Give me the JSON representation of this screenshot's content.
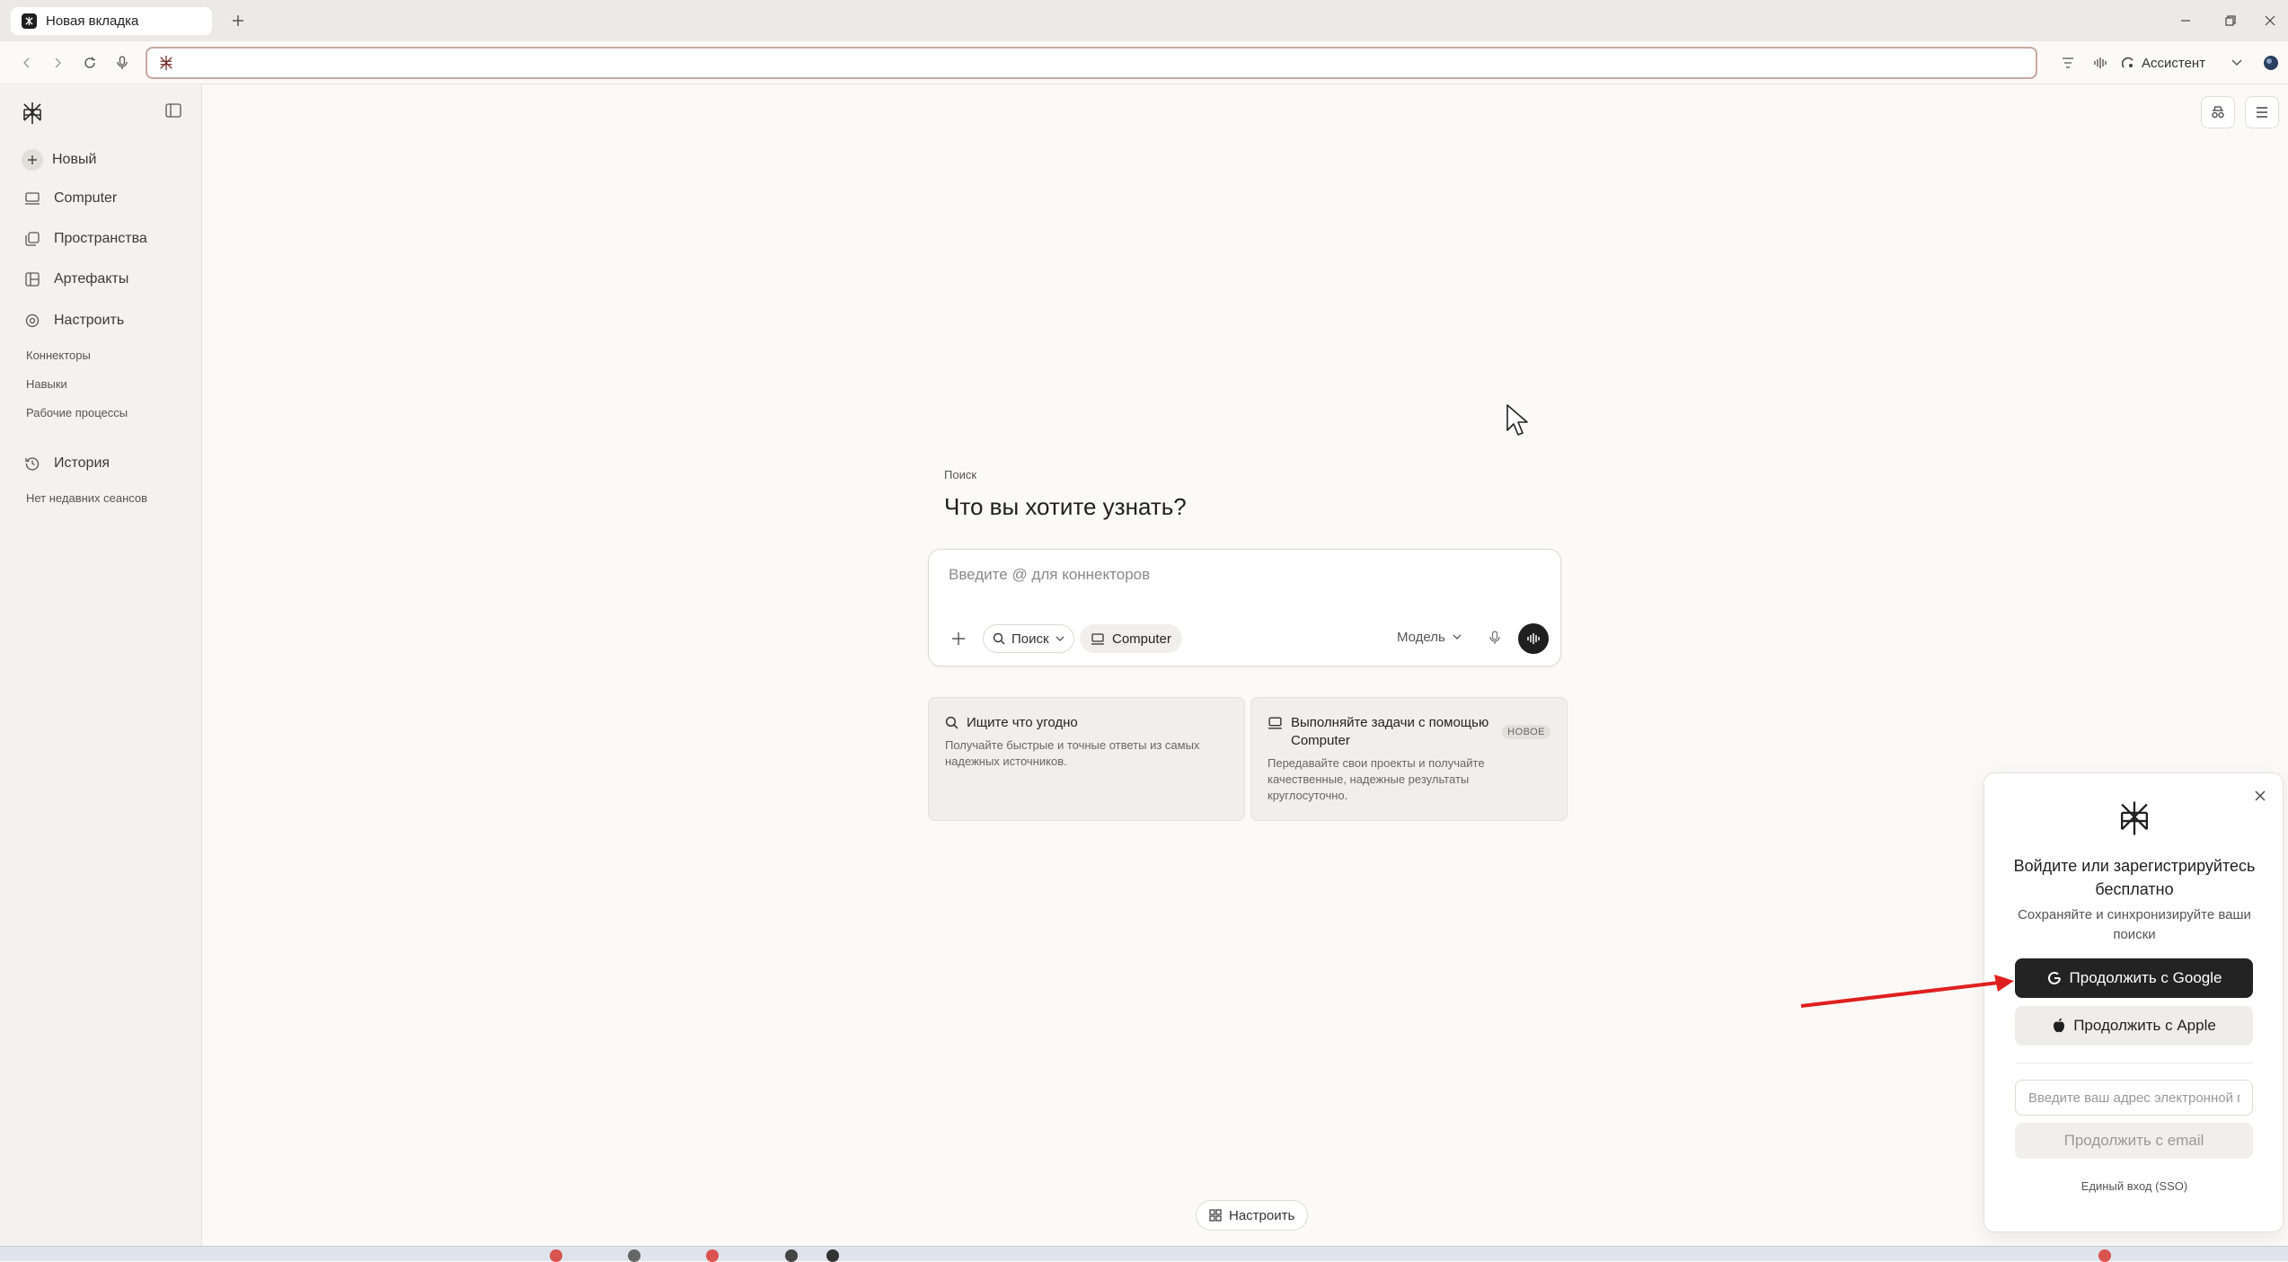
{
  "browser": {
    "tab_title": "Новая вкладка",
    "address_value": "",
    "assistant_label": "Ассистент"
  },
  "sidebar": {
    "items": [
      {
        "label": "Новый",
        "icon": "plus-icon"
      },
      {
        "label": "Computer",
        "icon": "computer-icon"
      },
      {
        "label": "Пространства",
        "icon": "spaces-icon"
      },
      {
        "label": "Артефакты",
        "icon": "artifacts-icon"
      },
      {
        "label": "Настроить",
        "icon": "customize-icon"
      }
    ],
    "sub_items": [
      "Коннекторы",
      "Навыки",
      "Рабочие процессы"
    ],
    "history_label": "История",
    "history_empty": "Нет недавних сеансов"
  },
  "main": {
    "eyebrow": "Поиск",
    "headline": "Что вы хотите узнать?",
    "composer": {
      "placeholder": "Введите @ для коннекторов",
      "search_chip": "Поиск",
      "computer_chip": "Computer",
      "model_label": "Модель"
    },
    "cards": [
      {
        "title": "Ищите что угодно",
        "desc": "Получайте быстрые и точные ответы из самых надежных источников."
      },
      {
        "title": "Выполняйте задачи с помощью Computer",
        "desc": "Передавайте свои проекты и получайте качественные, надежные результаты круглосуточно.",
        "badge": "НОВОЕ"
      }
    ],
    "settings_pill": "Настроить"
  },
  "modal": {
    "title": "Войдите или зарегистрируйтесь бесплатно",
    "subtitle": "Сохраняйте и синхронизируйте ваши поиски",
    "google_button": "Продолжить с Google",
    "apple_button": "Продолжить с Apple",
    "email_placeholder": "Введите ваш адрес электронной почты",
    "email_button": "Продолжить с email",
    "sso_link": "Единый вход (SSO)"
  },
  "colors": {
    "accent_dark": "#232323",
    "arrow_red": "#e02020",
    "omnibox_border": "#c8a8a0"
  }
}
